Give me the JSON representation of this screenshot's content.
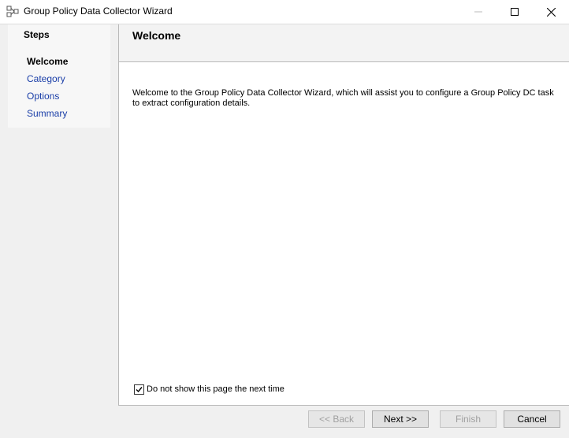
{
  "window": {
    "title": "Group Policy Data Collector Wizard",
    "icon": "group-policy-wizard-icon"
  },
  "sidebar": {
    "title": "Steps",
    "steps": [
      {
        "label": "Welcome",
        "state": "active"
      },
      {
        "label": "Category",
        "state": "link"
      },
      {
        "label": "Options",
        "state": "link"
      },
      {
        "label": "Summary",
        "state": "link"
      }
    ]
  },
  "header": {
    "title": "Welcome"
  },
  "content": {
    "message": "Welcome to the Group Policy Data Collector Wizard, which will assist you to configure a Group Policy DC task to extract configuration details.",
    "checkbox_label": "Do not show this page the next time",
    "checkbox_checked": true
  },
  "buttons": {
    "back": "<< Back",
    "next": "Next >>",
    "finish": "Finish",
    "cancel": "Cancel"
  },
  "colors": {
    "link": "#1a3ea8",
    "disabled_text": "#a0a0a0"
  }
}
